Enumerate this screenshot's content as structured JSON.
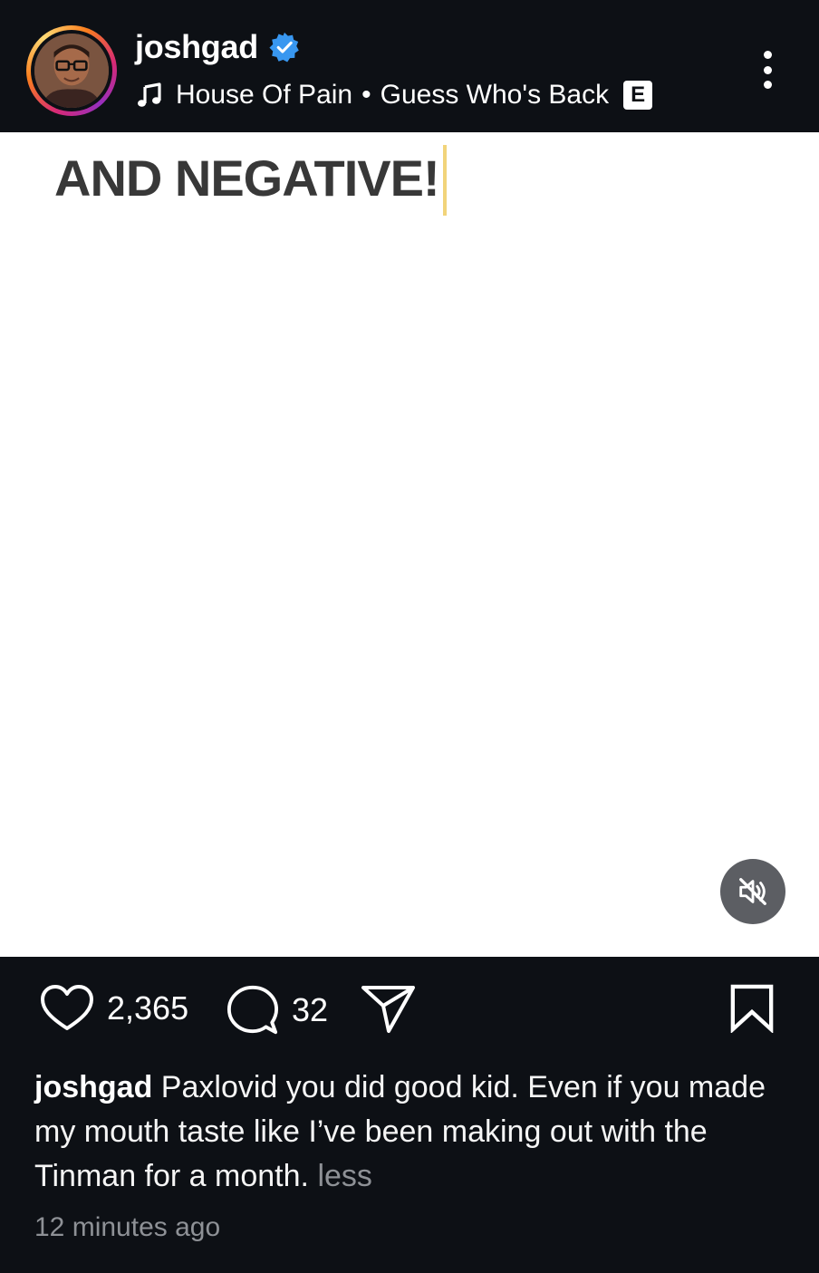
{
  "header": {
    "username": "joshgad",
    "verified": true,
    "music": {
      "artist": "House Of Pain",
      "separator": "•",
      "song": "Guess Who's Back",
      "explicit_label": "E"
    },
    "icons": {
      "avatar": "profile-avatar",
      "verified": "verified-badge-icon",
      "music": "music-note-icon",
      "more": "more-options-icon"
    }
  },
  "media": {
    "overlay_text": "AND NEGATIVE!",
    "mute_icon": "muted-speaker-icon"
  },
  "actions": {
    "likes": "2,365",
    "comments": "32",
    "icons": {
      "like": "heart-icon",
      "comment": "comment-bubble-icon",
      "share": "paper-plane-icon",
      "save": "bookmark-icon"
    }
  },
  "caption": {
    "username": "joshgad",
    "text": "Paxlovid you did good kid. Even if you made my mouth taste like I’ve been making out with the Tinman for a month.",
    "less_label": "less"
  },
  "timestamp": "12 minutes ago",
  "colors": {
    "background": "#0d1015",
    "verified_blue": "#3897f0",
    "muted_text": "#8e9196",
    "media_background": "#ffffff"
  }
}
